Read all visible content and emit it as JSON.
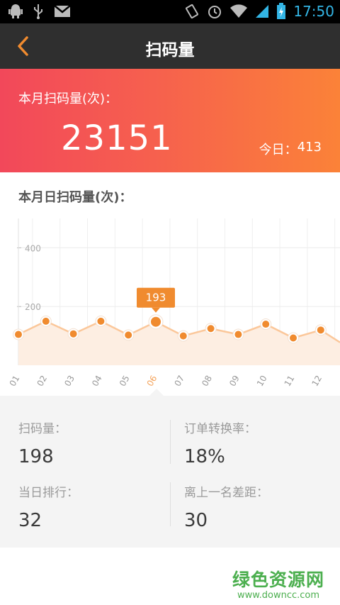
{
  "status_bar": {
    "time": "17:50",
    "icons": [
      "android-debug-icon",
      "usb-icon",
      "gmail-icon",
      "vibrate-icon",
      "alarm-icon",
      "wifi-icon",
      "signal-icon",
      "battery-charging-icon"
    ]
  },
  "nav": {
    "title": "扫码量",
    "back_icon": "chevron-left-icon"
  },
  "summary": {
    "label": "本月扫码量(次)：",
    "value": "23151",
    "today_label": "今日：",
    "today_value": "413"
  },
  "chart": {
    "title": "本月日扫码量(次)：",
    "tooltip": "193"
  },
  "chart_data": {
    "type": "area",
    "categories": [
      "01",
      "02",
      "03",
      "04",
      "05",
      "06",
      "07",
      "08",
      "09",
      "10",
      "11",
      "12"
    ],
    "values": [
      105,
      150,
      107,
      150,
      103,
      148,
      100,
      125,
      105,
      140,
      93,
      120
    ],
    "trailing_value": 78,
    "selected_index": 5,
    "selected_label": "193",
    "y_ticks": [
      200,
      400
    ],
    "ylim": [
      0,
      500
    ],
    "grid": true,
    "colors": {
      "line": "#fbc79a",
      "fill": "#fdeee2",
      "point": "#f08b2f",
      "selected_label": "#f4a35b"
    }
  },
  "stats": {
    "scan_count_label": "扫码量：",
    "scan_count_value": "198",
    "conversion_label": "订单转换率：",
    "conversion_value": "18%",
    "rank_label": "当日排行：",
    "rank_value": "32",
    "gap_label": "离上一名差距：",
    "gap_value": "30"
  },
  "watermark": {
    "cn": "绿色资源网",
    "url": "www.downcc.com"
  },
  "colors": {
    "accent": "#f08b2f",
    "header_gradient_start": "#f2485a",
    "header_gradient_end": "#fb8238",
    "nav_bg": "#2f2f2f",
    "back_arrow": "#f08b2f"
  }
}
